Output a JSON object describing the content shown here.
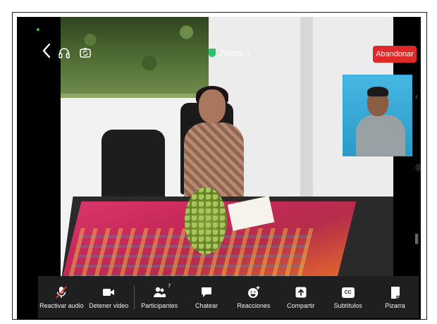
{
  "meeting": {
    "title": "Zoom",
    "leave_label": "Abandonar"
  },
  "toolbar": {
    "items": [
      {
        "label": "Reactivar audio",
        "icon": "mic-muted-icon"
      },
      {
        "label": "Detener video",
        "icon": "video-camera-icon"
      },
      {
        "label": "Participantes",
        "icon": "participants-icon",
        "count": "7"
      },
      {
        "label": "Chatear",
        "icon": "chat-bubble-icon"
      },
      {
        "label": "Reacciones",
        "icon": "reactions-icon"
      },
      {
        "label": "Compartir",
        "icon": "share-up-arrow-icon"
      },
      {
        "label": "Subtítulos",
        "icon": "cc-icon",
        "cc_text": "CC"
      },
      {
        "label": "Pizarra",
        "icon": "whiteboard-icon"
      }
    ]
  },
  "colors": {
    "leave_red": "#e02828",
    "secure_green": "#2bc46a",
    "toolbar_bg": "#1f1f1f",
    "thumbnail_border": "#2fa6d9"
  }
}
